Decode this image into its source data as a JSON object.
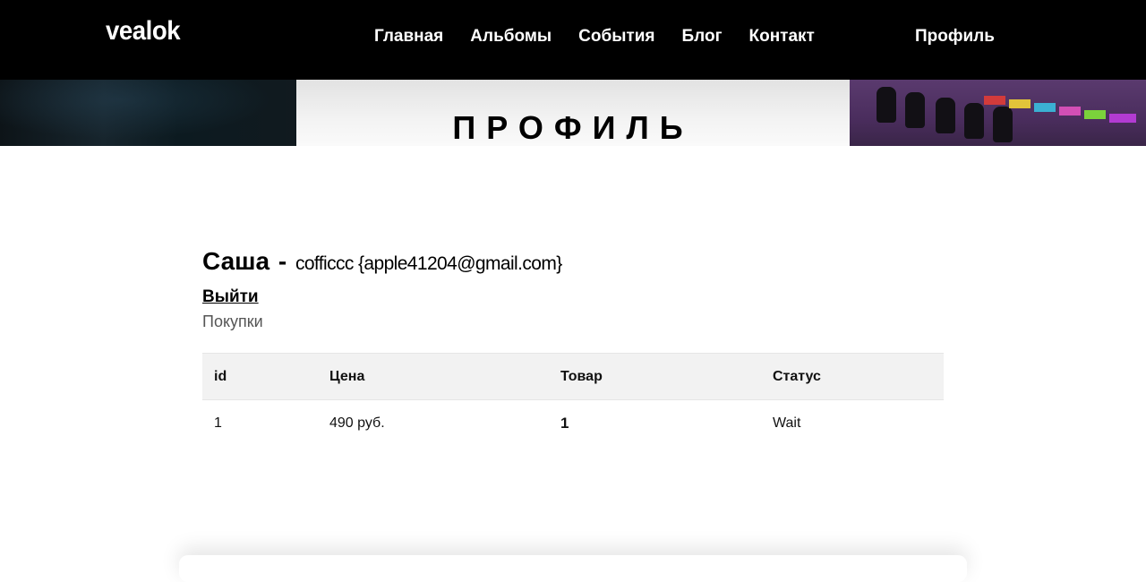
{
  "header": {
    "logo": "vealok",
    "nav": [
      "Главная",
      "Альбомы",
      "События",
      "Блог",
      "Контакт"
    ],
    "profile_link": "Профиль"
  },
  "banner": {
    "title": "ПРОФИЛЬ"
  },
  "user": {
    "name": "Саша",
    "separator": "-",
    "login_email": "cofficcc {apple41204@gmail.com}",
    "logout_label": "Выйти",
    "purchases_label": "Покупки"
  },
  "orders_table": {
    "columns": [
      "id",
      "Цена",
      "Товар",
      "Статус"
    ],
    "rows": [
      {
        "id": "1",
        "price": "490 руб.",
        "product": "1",
        "status": "Wait"
      }
    ]
  },
  "colors": {
    "header_bg": "#000000",
    "header_text": "#ffffff",
    "table_header_bg": "#f2f2f2",
    "muted_text": "#555555"
  }
}
